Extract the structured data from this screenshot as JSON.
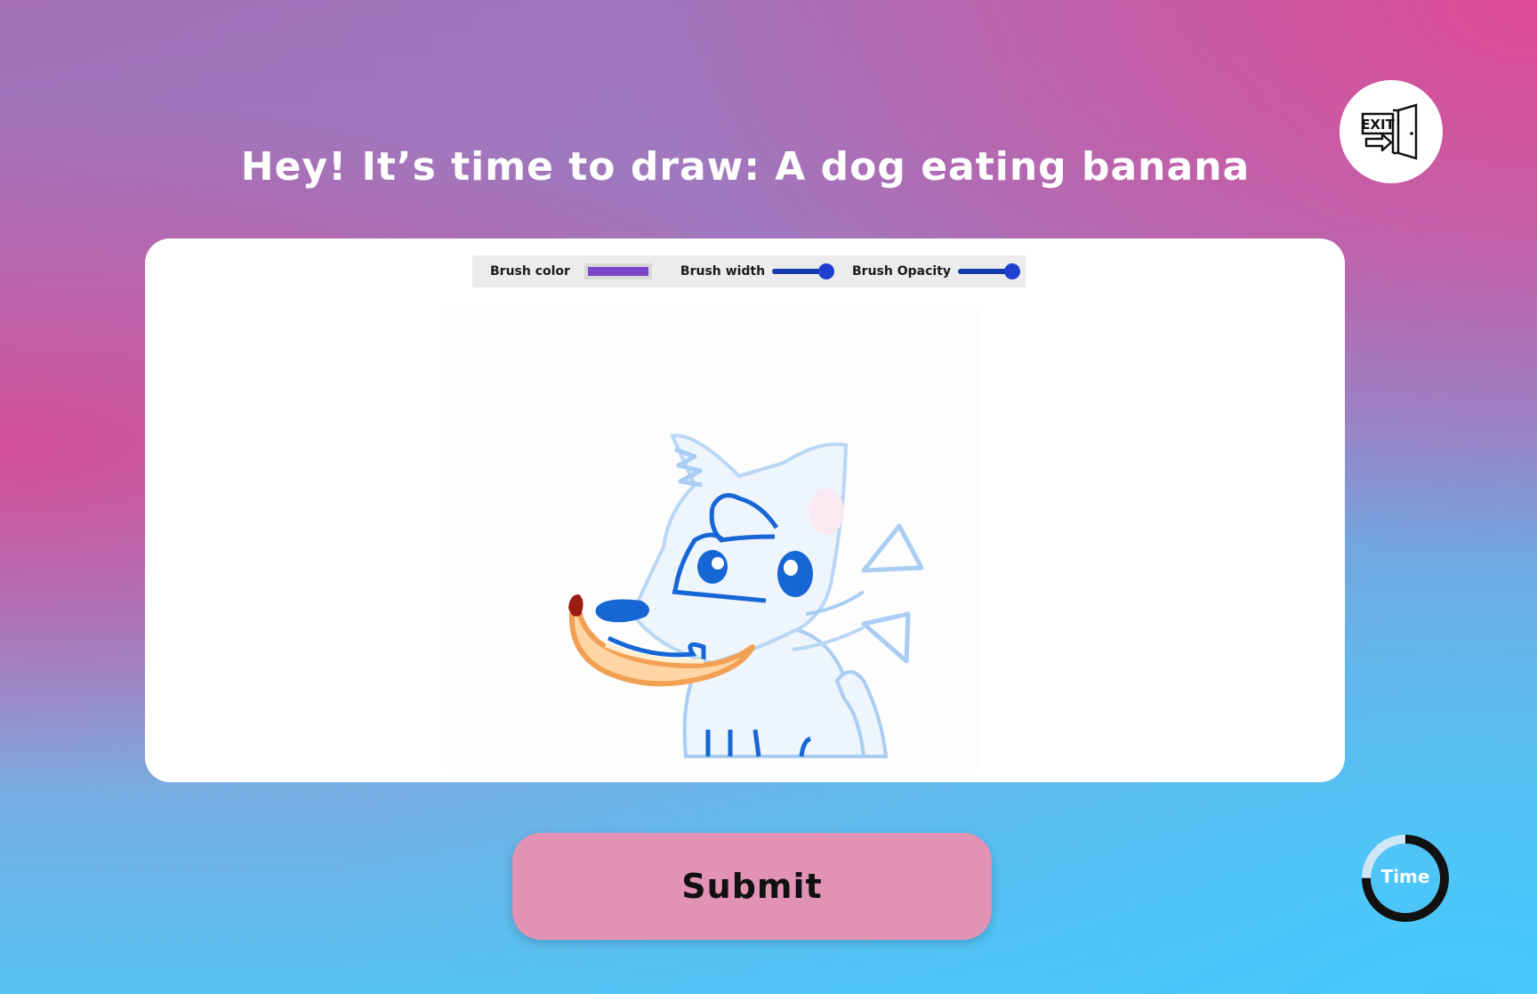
{
  "prompt": {
    "headline": "Hey! It’s time to draw: A dog eating banana"
  },
  "toolbar": {
    "brush_color_label": "Brush color",
    "brush_color": "#7a45c8",
    "brush_width_label": "Brush width",
    "brush_width_value": 0.9,
    "brush_opacity_label": "Brush Opacity",
    "brush_opacity_value": 0.9
  },
  "actions": {
    "submit_label": "Submit",
    "exit_icon": "exit-door-icon"
  },
  "timer": {
    "label": "Time",
    "remaining_fraction": 0.75
  },
  "colors": {
    "submit_button": "#e292b2",
    "slider_thumb": "#1f3fd1",
    "slider_track": "#123aa8",
    "timer_ring": "#111111",
    "timer_ring_bg": "#cfe6f7"
  }
}
